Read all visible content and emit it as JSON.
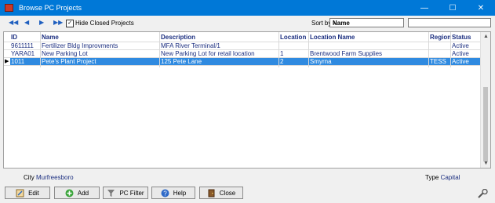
{
  "window": {
    "title": "Browse PC Projects"
  },
  "titlebar_buttons": {
    "minimize": "—",
    "maximize": "☐",
    "close": "✕"
  },
  "toolbar": {
    "nav_first": "◀◀",
    "nav_prev": "◀",
    "nav_next": "▶",
    "nav_last": "▶▶",
    "hide_closed_checked": "✓",
    "hide_closed_label": "Hide Closed Projects",
    "sort_label": "Sort by",
    "sort_value": "Name",
    "sort_arrow": "⌄",
    "search_value": ""
  },
  "grid": {
    "columns": [
      "ID",
      "Name",
      "Description",
      "Location",
      "Location Name",
      "Region",
      "Status"
    ],
    "rows": [
      {
        "id": "9611111",
        "name": "Fertilizer Bldg Improvments",
        "description": "MFA River Terminal/1",
        "location": "",
        "location_name": "",
        "region": "",
        "status": "Active"
      },
      {
        "id": "YARA01",
        "name": "New Parking Lot",
        "description": "New Parking Lot for retail location",
        "location": "1",
        "location_name": "Brentwood Farm Supplies",
        "region": "",
        "status": "Active"
      },
      {
        "id": "1011",
        "name": "Pete's Plant Project",
        "description": "125 Pete Lane",
        "location": "2",
        "location_name": "Smyrna",
        "region": "TESS",
        "status": "Active"
      }
    ],
    "current_row_marker": "▶"
  },
  "footer": {
    "city_label": "City",
    "city_value": "Murfreesboro",
    "type_label": "Type",
    "type_value": "Capital"
  },
  "buttons": {
    "edit": "Edit",
    "add": "Add",
    "pc_filter": "PC Filter",
    "help": "Help",
    "close": "Close"
  },
  "colors": {
    "titlebar": "#0078d7",
    "selection": "#2f8ae0",
    "text_blue": "#1c2f80"
  }
}
